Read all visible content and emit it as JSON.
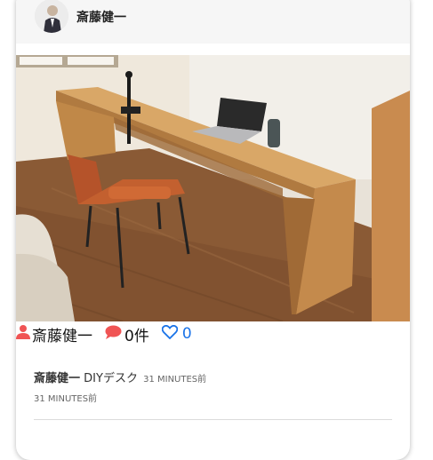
{
  "header": {
    "author_name": "斎藤健一"
  },
  "photo": {
    "subject": "DIY wooden desk with laptop and orange chair"
  },
  "meta": {
    "author_label": "斎藤健一",
    "comment_count": "0件",
    "like_count": "0"
  },
  "post": {
    "author": "斎藤健一",
    "title": "DIYデスク",
    "time": "31 MINUTES前",
    "time_secondary": "31 MINUTES前"
  },
  "colors": {
    "accent_red": "#f05454",
    "like_blue": "#1a73e8"
  },
  "icons": {
    "author": "user-icon",
    "comments": "comment-icon",
    "likes": "heart-icon"
  }
}
